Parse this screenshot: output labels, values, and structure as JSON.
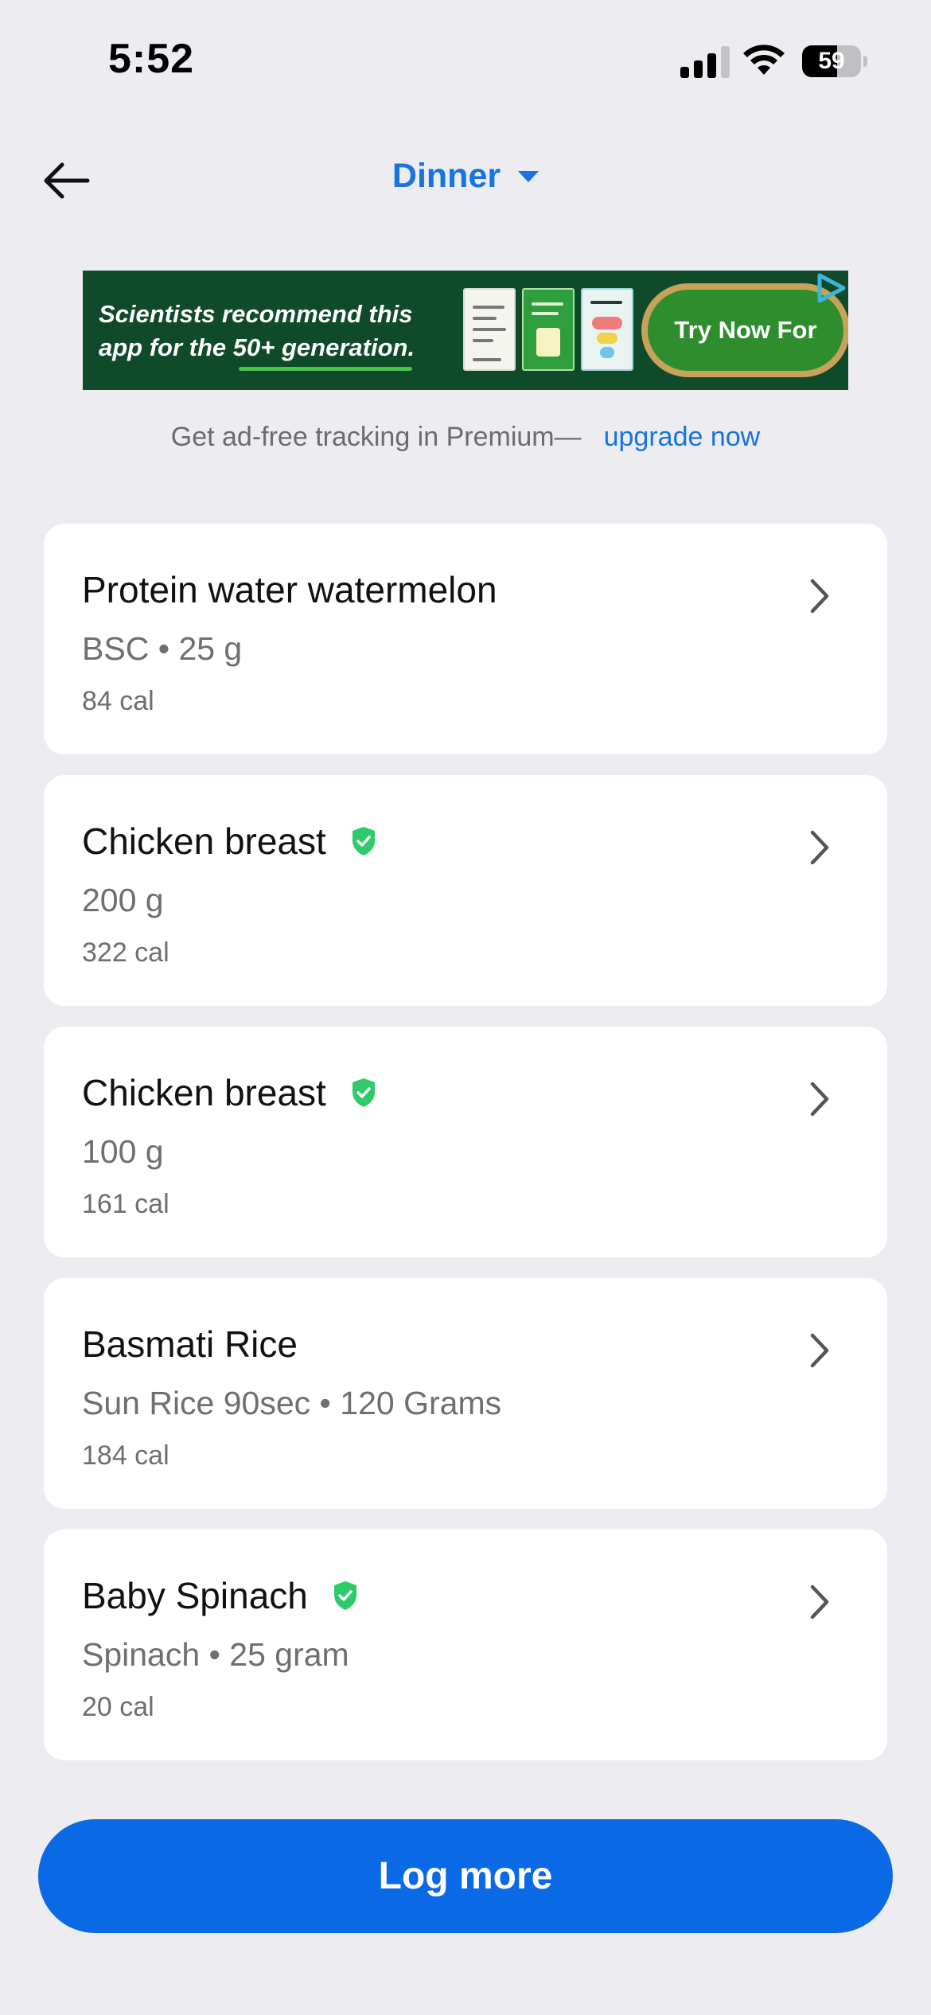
{
  "status_bar": {
    "time": "5:52",
    "battery": "59",
    "battery_level": 0.59
  },
  "nav": {
    "meal_title": "Dinner"
  },
  "ad": {
    "headline_line1": "Scientists recommend this",
    "headline_line2": "app for the 50+ generation.",
    "cta": "Try Now For Free"
  },
  "premium": {
    "text": "Get ad-free tracking in Premium—",
    "link": "upgrade now"
  },
  "foods": [
    {
      "name": "Protein water watermelon",
      "verified": false,
      "detail": "BSC • 25 g",
      "calories": "84 cal"
    },
    {
      "name": "Chicken breast",
      "verified": true,
      "detail": "200 g",
      "calories": "322 cal"
    },
    {
      "name": "Chicken breast",
      "verified": true,
      "detail": "100 g",
      "calories": "161 cal"
    },
    {
      "name": "Basmati Rice",
      "verified": false,
      "detail": "Sun Rice 90sec • 120 Grams",
      "calories": "184 cal"
    },
    {
      "name": "Baby Spinach",
      "verified": true,
      "detail": "Spinach • 25 gram",
      "calories": "20 cal"
    }
  ],
  "actions": {
    "log_more": "Log more"
  },
  "colors": {
    "accent": "#0a6ae6",
    "verified": "#2fcb6b",
    "background": "#ececf1"
  }
}
